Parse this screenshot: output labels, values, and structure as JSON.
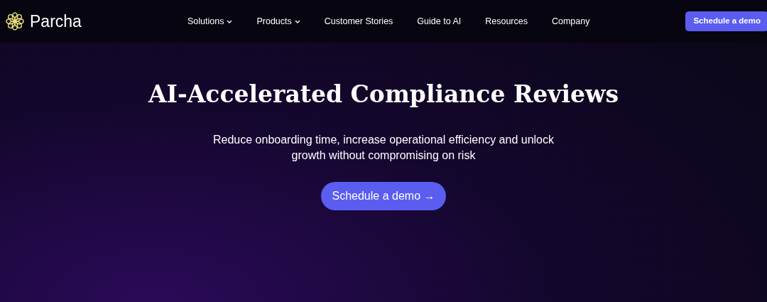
{
  "header": {
    "logo": "Parcha",
    "nav": [
      {
        "label": "Solutions",
        "kind": "dropdown"
      },
      {
        "label": "Products",
        "kind": "dropdown"
      },
      {
        "label": "Customer Stories",
        "kind": "link"
      },
      {
        "label": "Guide to AI",
        "kind": "link"
      },
      {
        "label": "Resources",
        "kind": "link"
      },
      {
        "label": "Company",
        "kind": "link"
      }
    ],
    "cta": "Schedule a demo"
  },
  "hero": {
    "title": "AI-Accelerated Compliance Reviews",
    "subtitle": "Reduce onboarding time, increase operational efficiency and unlock growth without compromising on risk",
    "cta": "Schedule a demo →"
  }
}
